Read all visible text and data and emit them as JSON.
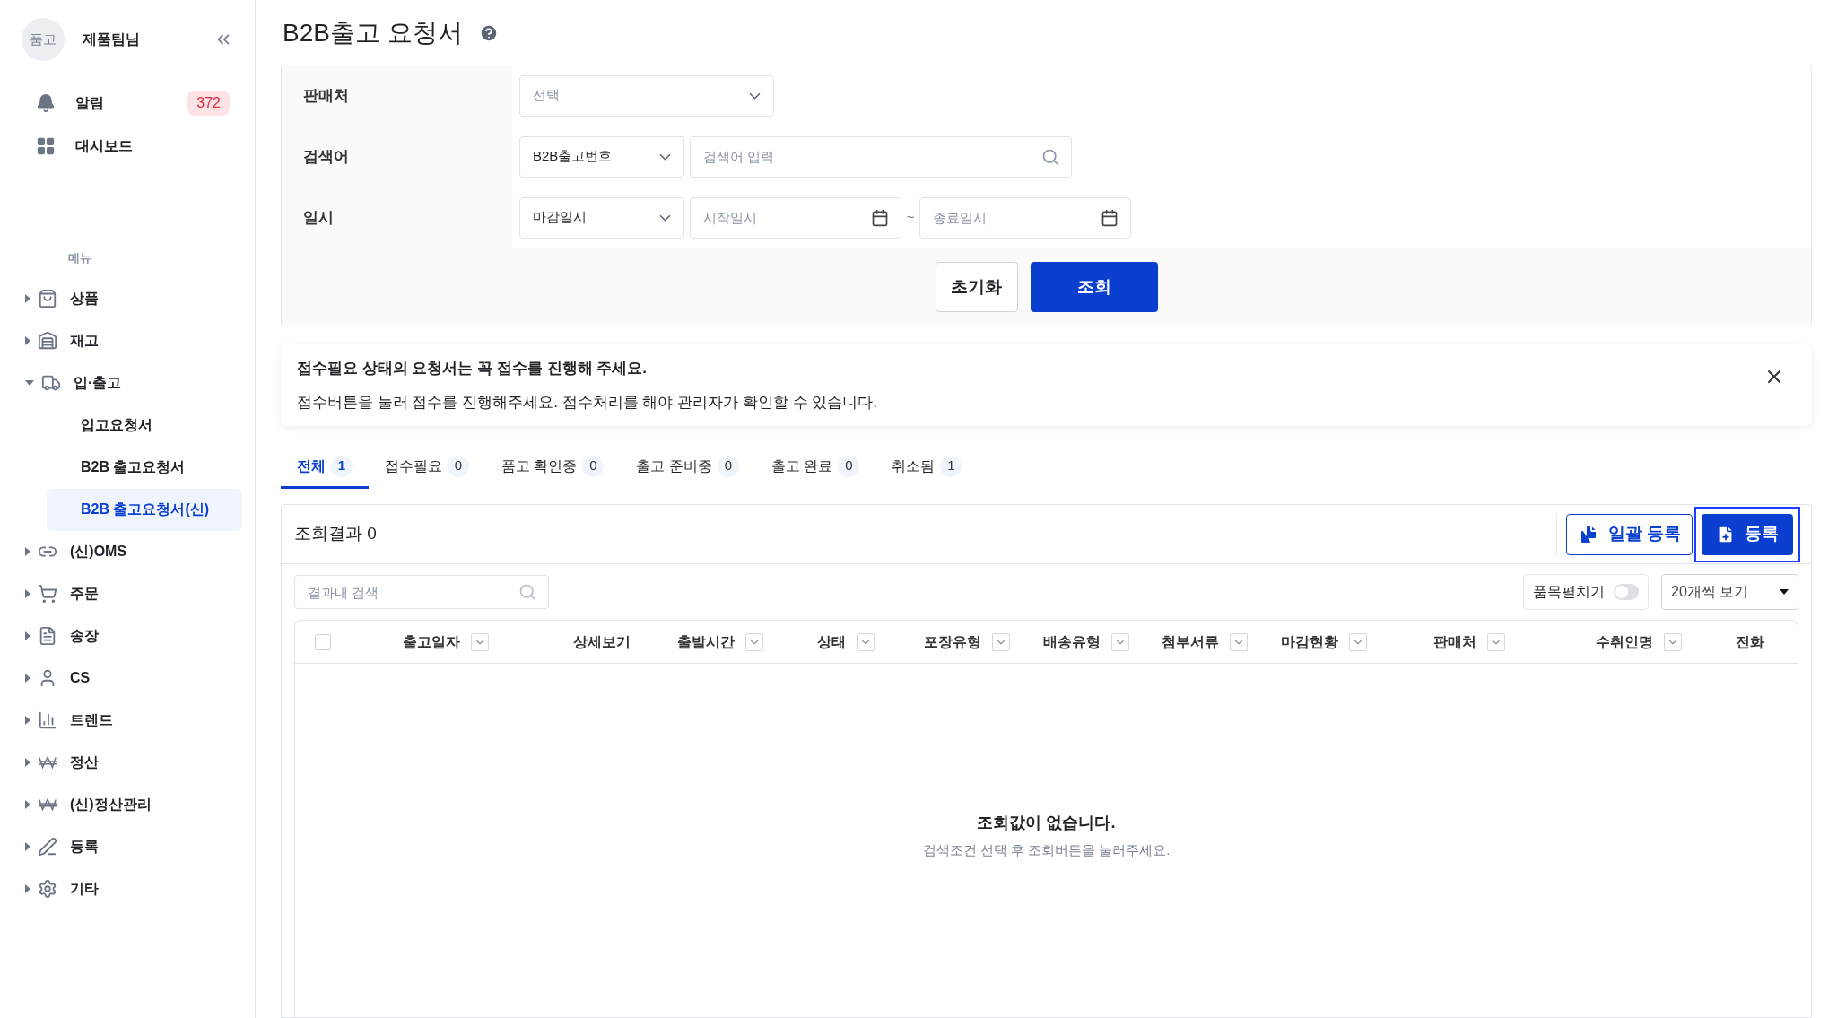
{
  "sidebar": {
    "avatar": "품고",
    "user": "제품팀님",
    "top_items": [
      {
        "label": "알림",
        "badge": "372"
      },
      {
        "label": "대시보드"
      }
    ],
    "menu_title": "메뉴",
    "menu": [
      {
        "label": "상품",
        "expanded": false
      },
      {
        "label": "재고",
        "expanded": false
      },
      {
        "label": "입·출고",
        "expanded": true,
        "children": [
          {
            "label": "입고요청서",
            "selected": false
          },
          {
            "label": "B2B 출고요청서",
            "selected": false
          },
          {
            "label": "B2B 출고요청서(신)",
            "selected": true
          }
        ]
      },
      {
        "label": "(신)OMS",
        "expanded": false
      },
      {
        "label": "주문",
        "expanded": false
      },
      {
        "label": "송장",
        "expanded": false
      },
      {
        "label": "CS",
        "expanded": false
      },
      {
        "label": "트렌드",
        "expanded": false
      },
      {
        "label": "정산",
        "expanded": false
      },
      {
        "label": "(신)정산관리",
        "expanded": false
      },
      {
        "label": "등록",
        "expanded": false
      },
      {
        "label": "기타",
        "expanded": false
      }
    ]
  },
  "page": {
    "title": "B2B출고 요청서"
  },
  "filters": {
    "seller": {
      "label": "판매처",
      "placeholder": "선택"
    },
    "keyword": {
      "label": "검색어",
      "type": "B2B출고번호",
      "placeholder": "검색어 입력"
    },
    "date": {
      "label": "일시",
      "type": "마감일시",
      "start_placeholder": "시작일시",
      "separator": "~",
      "end_placeholder": "종료일시"
    },
    "reset_button": "초기화",
    "search_button": "조회"
  },
  "notice": {
    "title": "접수필요 상태의 요청서는 꼭 접수를 진행해 주세요.",
    "text": "접수버튼을 눌러 접수를 진행해주세요. 접수처리를 해야 관리자가 확인할 수 있습니다."
  },
  "tabs": [
    {
      "label": "전체",
      "count": "1",
      "selected": true
    },
    {
      "label": "접수필요",
      "count": "0",
      "selected": false
    },
    {
      "label": "품고 확인중",
      "count": "0",
      "selected": false
    },
    {
      "label": "출고 준비중",
      "count": "0",
      "selected": false
    },
    {
      "label": "출고 완료",
      "count": "0",
      "selected": false
    },
    {
      "label": "취소됨",
      "count": "1",
      "selected": false
    }
  ],
  "results": {
    "count_label": "조회결과 0",
    "bulk_button": "일괄 등록",
    "register_button": {
      "label": "등록",
      "highlighted": true
    },
    "search_placeholder": "결과내 검색",
    "expand_toggle": {
      "label": "품목펼치기",
      "on": false
    },
    "page_size": "20개씩 보기"
  },
  "table": {
    "columns": [
      {
        "label": "출고일자",
        "filter": true
      },
      {
        "label": "상세보기",
        "filter": false
      },
      {
        "label": "출발시간",
        "filter": true
      },
      {
        "label": "상태",
        "filter": true
      },
      {
        "label": "포장유형",
        "filter": true
      },
      {
        "label": "배송유형",
        "filter": true
      },
      {
        "label": "첨부서류",
        "filter": true
      },
      {
        "label": "마감현황",
        "filter": true
      },
      {
        "label": "판매처",
        "filter": true
      },
      {
        "label": "수취인명",
        "filter": true
      },
      {
        "label": "전화",
        "filter": false
      }
    ],
    "select_all_checked": false,
    "empty_title": "조회값이 없습니다.",
    "empty_text": "검색조건 선택 후 조회버튼을 눌러주세요."
  }
}
